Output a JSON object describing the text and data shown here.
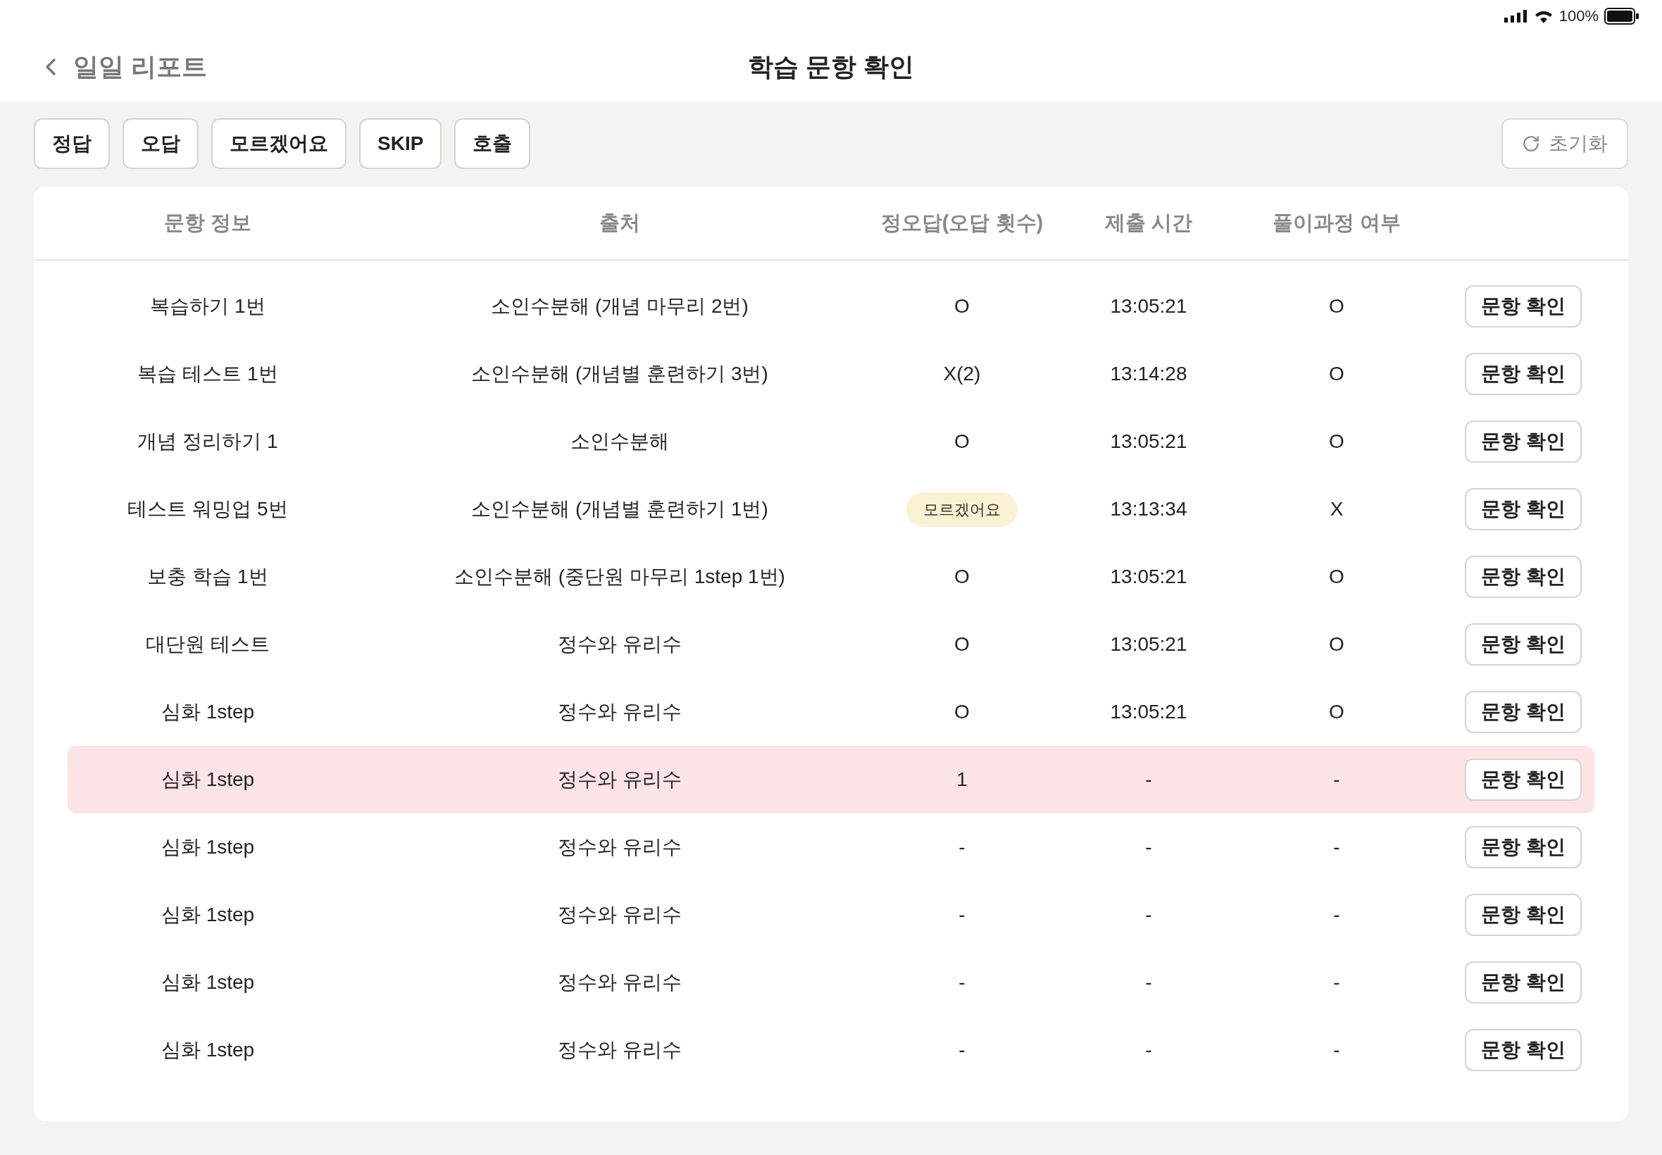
{
  "status_bar": {
    "battery": "100%"
  },
  "header": {
    "back_label": "일일 리포트",
    "title": "학습 문항 확인"
  },
  "filters": [
    "정답",
    "오답",
    "모르겠어요",
    "SKIP",
    "호출"
  ],
  "reset_button": "초기화",
  "table": {
    "columns": [
      "문항 정보",
      "출처",
      "정오답(오답 횟수)",
      "제출 시간",
      "풀이과정 여부"
    ],
    "rows": [
      {
        "info": "복습하기 1번",
        "source": "소인수분해 (개념 마무리 2번)",
        "result": {
          "kind": "text",
          "text": "O"
        },
        "time": "13:05:21",
        "process": "O",
        "action": "문항 확인",
        "highlighted": false
      },
      {
        "info": "복습 테스트 1번",
        "source": "소인수분해 (개념별 훈련하기 3번)",
        "result": {
          "kind": "text",
          "text": "X(2)"
        },
        "time": "13:14:28",
        "process": "O",
        "action": "문항 확인",
        "highlighted": false
      },
      {
        "info": "개념 정리하기 1",
        "source": "소인수분해",
        "result": {
          "kind": "text",
          "text": "O"
        },
        "time": "13:05:21",
        "process": "O",
        "action": "문항 확인",
        "highlighted": false
      },
      {
        "info": "테스트 워밍업 5번",
        "source": "소인수분해 (개념별 훈련하기 1번)",
        "result": {
          "kind": "badge",
          "text": "모르겠어요"
        },
        "time": "13:13:34",
        "process": "X",
        "action": "문항 확인",
        "highlighted": false
      },
      {
        "info": "보충 학습 1번",
        "source": "소인수분해 (중단원 마무리 1step 1번)",
        "result": {
          "kind": "text",
          "text": "O"
        },
        "time": "13:05:21",
        "process": "O",
        "action": "문항 확인",
        "highlighted": false
      },
      {
        "info": "대단원 테스트",
        "source": "정수와 유리수",
        "result": {
          "kind": "text",
          "text": "O"
        },
        "time": "13:05:21",
        "process": "O",
        "action": "문항 확인",
        "highlighted": false
      },
      {
        "info": "심화 1step",
        "source": "정수와 유리수",
        "result": {
          "kind": "text",
          "text": "O"
        },
        "time": "13:05:21",
        "process": "O",
        "action": "문항 확인",
        "highlighted": false
      },
      {
        "info": "심화 1step",
        "source": "정수와 유리수",
        "result": {
          "kind": "text",
          "text": "1"
        },
        "time": "-",
        "process": "-",
        "action": "문항 확인",
        "highlighted": true
      },
      {
        "info": "심화 1step",
        "source": "정수와 유리수",
        "result": {
          "kind": "text",
          "text": "-"
        },
        "time": "-",
        "process": "-",
        "action": "문항 확인",
        "highlighted": false
      },
      {
        "info": "심화 1step",
        "source": "정수와 유리수",
        "result": {
          "kind": "text",
          "text": "-"
        },
        "time": "-",
        "process": "-",
        "action": "문항 확인",
        "highlighted": false
      },
      {
        "info": "심화 1step",
        "source": "정수와 유리수",
        "result": {
          "kind": "text",
          "text": "-"
        },
        "time": "-",
        "process": "-",
        "action": "문항 확인",
        "highlighted": false
      },
      {
        "info": "심화 1step",
        "source": "정수와 유리수",
        "result": {
          "kind": "text",
          "text": "-"
        },
        "time": "-",
        "process": "-",
        "action": "문항 확인",
        "highlighted": false
      }
    ]
  }
}
